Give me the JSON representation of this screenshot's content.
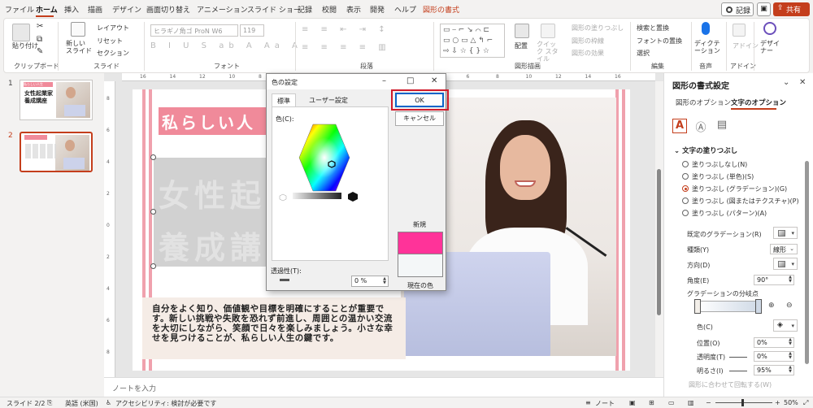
{
  "menu": {
    "items": [
      "ファイル",
      "ホーム",
      "挿入",
      "描画",
      "デザイン",
      "画面切り替え",
      "アニメーション",
      "スライド ショー",
      "記録",
      "校閲",
      "表示",
      "開発",
      "ヘルプ"
    ],
    "shape_format": "図形の書式",
    "record": "記録",
    "share": "共有"
  },
  "ribbon": {
    "clipboard": {
      "paste": "貼り付け",
      "label": "クリップボード"
    },
    "slides": {
      "new_slide": "新しい スライド",
      "layout": "レイアウト",
      "reset": "リセット",
      "section": "セクション",
      "label": "スライド"
    },
    "font": {
      "name": "ヒラギノ角ゴ ProN W6",
      "size": "119",
      "label": "フォント"
    },
    "paragraph": {
      "label": "段落"
    },
    "drawing": {
      "arrange": "配置",
      "quick_style": "クイック スタイル",
      "fill": "図形の塗りつぶし",
      "outline": "図形の枠線",
      "effects": "図形の効果",
      "label": "図形描画"
    },
    "editing": {
      "find_replace": "検索と置換",
      "font_replace": "フォントの置換",
      "select": "選択",
      "label": "編集"
    },
    "voice": {
      "dictate": "ディクテーション",
      "label": "音声"
    },
    "addins": {
      "addins": "アドイン",
      "label": "アドイン"
    },
    "designer": {
      "label": "デザイナー"
    }
  },
  "thumbs": {
    "slide1": {
      "num": "1",
      "tag": "私らしい人生",
      "line1": "女性起業家",
      "line2": "養成講座"
    },
    "slide2": {
      "num": "2"
    }
  },
  "slide": {
    "title": "私らしい人",
    "ghost1": "女性起",
    "ghost2": "養成講",
    "body": "自分をよく知り、価値観や目標を明確にすることが重要です。新しい挑戦や失敗を恐れず前進し、周囲との温かい交流を大切にしながら、笑顔で日々を楽しみましょう。小さな幸せを見つけることが、私らしい人生の鍵です。"
  },
  "notes": {
    "placeholder": "ノートを入力"
  },
  "ruler_top": [
    "16",
    "14",
    "12",
    "10",
    "8",
    "6",
    "4",
    "2",
    "0",
    "2",
    "4",
    "6",
    "8",
    "10",
    "12",
    "14",
    "16"
  ],
  "ruler_left": [
    "8",
    "6",
    "4",
    "2",
    "0",
    "2",
    "4",
    "6",
    "8"
  ],
  "status": {
    "slide": "スライド 2/2",
    "language": "英語 (米国)",
    "accessibility": "アクセシビリティ: 検討が必要です",
    "notes": "ノート",
    "zoom": "50%"
  },
  "format_pane": {
    "title": "図形の書式設定",
    "tab_shape": "図形のオプション",
    "tab_text": "文字のオプション",
    "section": "文字の塗りつぶし",
    "options": [
      "塗りつぶしなし(N)",
      "塗りつぶし (単色)(S)",
      "塗りつぶし (グラデーション)(G)",
      "塗りつぶし (図またはテクスチャ)(P)",
      "塗りつぶし (パターン)(A)"
    ],
    "preset": "既定のグラデーション(R)",
    "type_label": "種類(Y)",
    "type_value": "線形",
    "direction": "方向(D)",
    "angle_label": "角度(E)",
    "angle_value": "90°",
    "stops_label": "グラデーションの分岐点",
    "color_label": "色(C)",
    "position_label": "位置(O)",
    "position_value": "0%",
    "transparency_label": "透明度(T)",
    "transparency_value": "0%",
    "brightness_label": "明るさ(I)",
    "brightness_value": "95%",
    "rotate_with_shape": "図形に合わせて回転する(W)"
  },
  "dialog": {
    "title": "色の設定",
    "tab_standard": "標準",
    "tab_custom": "ユーザー設定",
    "colors_label": "色(C):",
    "ok": "OK",
    "cancel": "キャンセル",
    "new_label": "新規",
    "current_label": "現在の色",
    "transparency_label": "透過性(T):",
    "transparency_value": "0 %"
  },
  "colors": {
    "accent": "#c43e1c",
    "new_color": "#ff3399",
    "current_color": "#f4f7f8",
    "title_pink": "#f08a9a"
  }
}
